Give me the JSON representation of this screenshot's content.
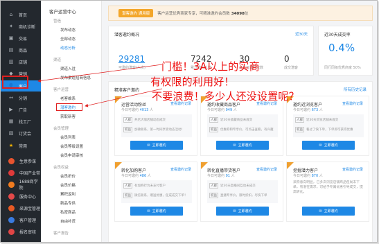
{
  "nav": {
    "items": [
      {
        "label": "首页",
        "icon": "home-icon",
        "glyph": "⌂"
      },
      {
        "label": "商机诊断",
        "icon": "diagnosis-icon",
        "glyph": "✦"
      },
      {
        "label": "交易",
        "icon": "trade-icon",
        "glyph": "▣"
      },
      {
        "label": "商品",
        "icon": "goods-icon",
        "glyph": "▤"
      },
      {
        "label": "店铺",
        "icon": "shop-icon",
        "glyph": "▥"
      },
      {
        "label": "营销",
        "icon": "marketing-icon",
        "glyph": "◆"
      },
      {
        "label": "客户",
        "icon": "customer-icon",
        "glyph": "👤"
      },
      {
        "label": "分销",
        "icon": "distribution-icon",
        "glyph": "↔"
      },
      {
        "label": "广告",
        "icon": "ad-icon",
        "glyph": "▶"
      },
      {
        "label": "找工厂",
        "icon": "factory-icon",
        "glyph": "▦"
      },
      {
        "label": "订货会",
        "icon": "order-fair-icon",
        "glyph": "▧"
      }
    ],
    "common_label": "常用",
    "sub_items": [
      {
        "label": "生意参谋",
        "color": "#e8542f"
      },
      {
        "label": "中国产业带",
        "color": "#e03a3a"
      },
      {
        "label": "1688商学院",
        "color": "#f07b1f"
      },
      {
        "label": "服务中心",
        "color": "#e34949"
      },
      {
        "label": "采源宝管理",
        "color": "#e85a24"
      },
      {
        "label": "客户管理",
        "color": "#3a7be0"
      },
      {
        "label": "报名审核",
        "color": "#e04545"
      }
    ]
  },
  "menu": {
    "title": "客户运营中心",
    "groups": [
      {
        "label": "营造",
        "items": [
          {
            "label": "发布动态"
          },
          {
            "label": "全部动态"
          },
          {
            "label": "动态分析",
            "current": true
          }
        ]
      },
      {
        "label": "渠道",
        "items": [
          {
            "label": "渠道入驻"
          },
          {
            "label": "发布渠道招商信息"
          }
        ]
      },
      {
        "label": "客户运营",
        "items": [
          {
            "label": "老客维系"
          },
          {
            "label": "潜客邀约",
            "current": true
          },
          {
            "label": "获取新客"
          }
        ]
      },
      {
        "label": "会员管理",
        "items": [
          {
            "label": "会员列表"
          },
          {
            "label": "会员等级设置"
          },
          {
            "label": "会员申请审核"
          }
        ]
      },
      {
        "label": "会员权益",
        "items": [
          {
            "label": "会员折价"
          },
          {
            "label": "会员价格"
          },
          {
            "label": "累积返利"
          },
          {
            "label": "新品专供"
          },
          {
            "label": "私密商品"
          },
          {
            "label": "自由补货"
          }
        ]
      },
      {
        "label": "客户报告",
        "items": []
      }
    ]
  },
  "banner": {
    "badge": "潜客邀约 通用版",
    "text": "客户运营优秀商家专享，可精准邀约会员数",
    "count": "34098",
    "suffix": "位"
  },
  "overview": {
    "title": "潜客邀约概况",
    "link": "近30天",
    "stats": [
      {
        "value": "29281",
        "label": "可邀约潜客(人次)"
      },
      {
        "value": "7242",
        "label": "累计邀约人数"
      },
      {
        "value": "30",
        "label": "今日可邀约次数"
      },
      {
        "value": "0",
        "label": "成交潜客"
      }
    ]
  },
  "rate": {
    "title": "近30天成交率",
    "value": "0.4%",
    "label": "同行同级优秀商家 50%"
  },
  "tasks": {
    "title": "精准客户邀约",
    "link": "所有历史记录"
  },
  "coupons": [
    {
      "name": "运营活动粉丝",
      "link": "查看邀约记录",
      "count_label": "今日可邀约",
      "count": "4013",
      "unit": "人",
      "rows": [
        {
          "tag": "人群",
          "text": "开店大咖店铺动态成交"
        },
        {
          "tag": "权益",
          "text": "加微联系，第一时间享受动态活动！"
        }
      ],
      "button": "立即邀约"
    },
    {
      "name": "邀约收藏商品客户",
      "link": "查看邀约记录",
      "count_label": "今日可邀约",
      "count": "949",
      "unit": "人",
      "rows": [
        {
          "tag": "人群",
          "text": "近30天收藏商品未成交"
        },
        {
          "tag": "权益",
          "text": "优惠券和专享价，可点击查看，有兴趣"
        }
      ],
      "button": "立即邀约"
    },
    {
      "name": "邀约近浏览客户",
      "link": "查看邀约记录",
      "count_label": "今日可邀约",
      "count": "673",
      "unit": "人",
      "rows": [
        {
          "tag": "人群",
          "text": "近30天浏览店铺未成交"
        },
        {
          "tag": "权益",
          "text": "看过了快下单，下单即可获得优惠"
        }
      ],
      "button": "立即邀约"
    },
    {
      "name": "转化加购客户",
      "link": "查看邀约记录",
      "count_label": "今日可邀约",
      "count": "486",
      "unit": "人",
      "rows": [
        {
          "tag": "人群",
          "text": "有加购行为未支付客户"
        },
        {
          "tag": "权益",
          "text": "微信联系，赠送优惠，促成成交下单！"
        }
      ],
      "button": "立即邀约"
    },
    {
      "name": "转化直播带货客户",
      "link": "查看邀约记录",
      "count_label": "今日可邀约",
      "count": "91",
      "unit": "人",
      "rows": [
        {
          "tag": "人群",
          "text": "近30天直播间互动未成交"
        },
        {
          "tag": "权益",
          "text": "直播专享价，限时折扣，尽快下单"
        }
      ],
      "button": "立即邀约"
    },
    {
      "name": "挖掘潜力客户",
      "link": "查看邀约记录",
      "count_label": "今日可邀约",
      "count": "870",
      "unit": "人",
      "desc": "采购意向明显，已多次浏览店铺商品但尚未下单，有潜在需求，可给予专属优惠引导成交，提高转化。",
      "button": "立即邀约"
    }
  ],
  "annotation": {
    "line1": "门槛！3A以上的实商",
    "line2": "有权限的利用好！",
    "line3": "不要浪费！多少人还没设置呢？"
  },
  "colors": {
    "nav_bg": "#23282e",
    "accent": "#1e88e5",
    "highlight": "#e02020",
    "badge": "#f3a62a"
  }
}
